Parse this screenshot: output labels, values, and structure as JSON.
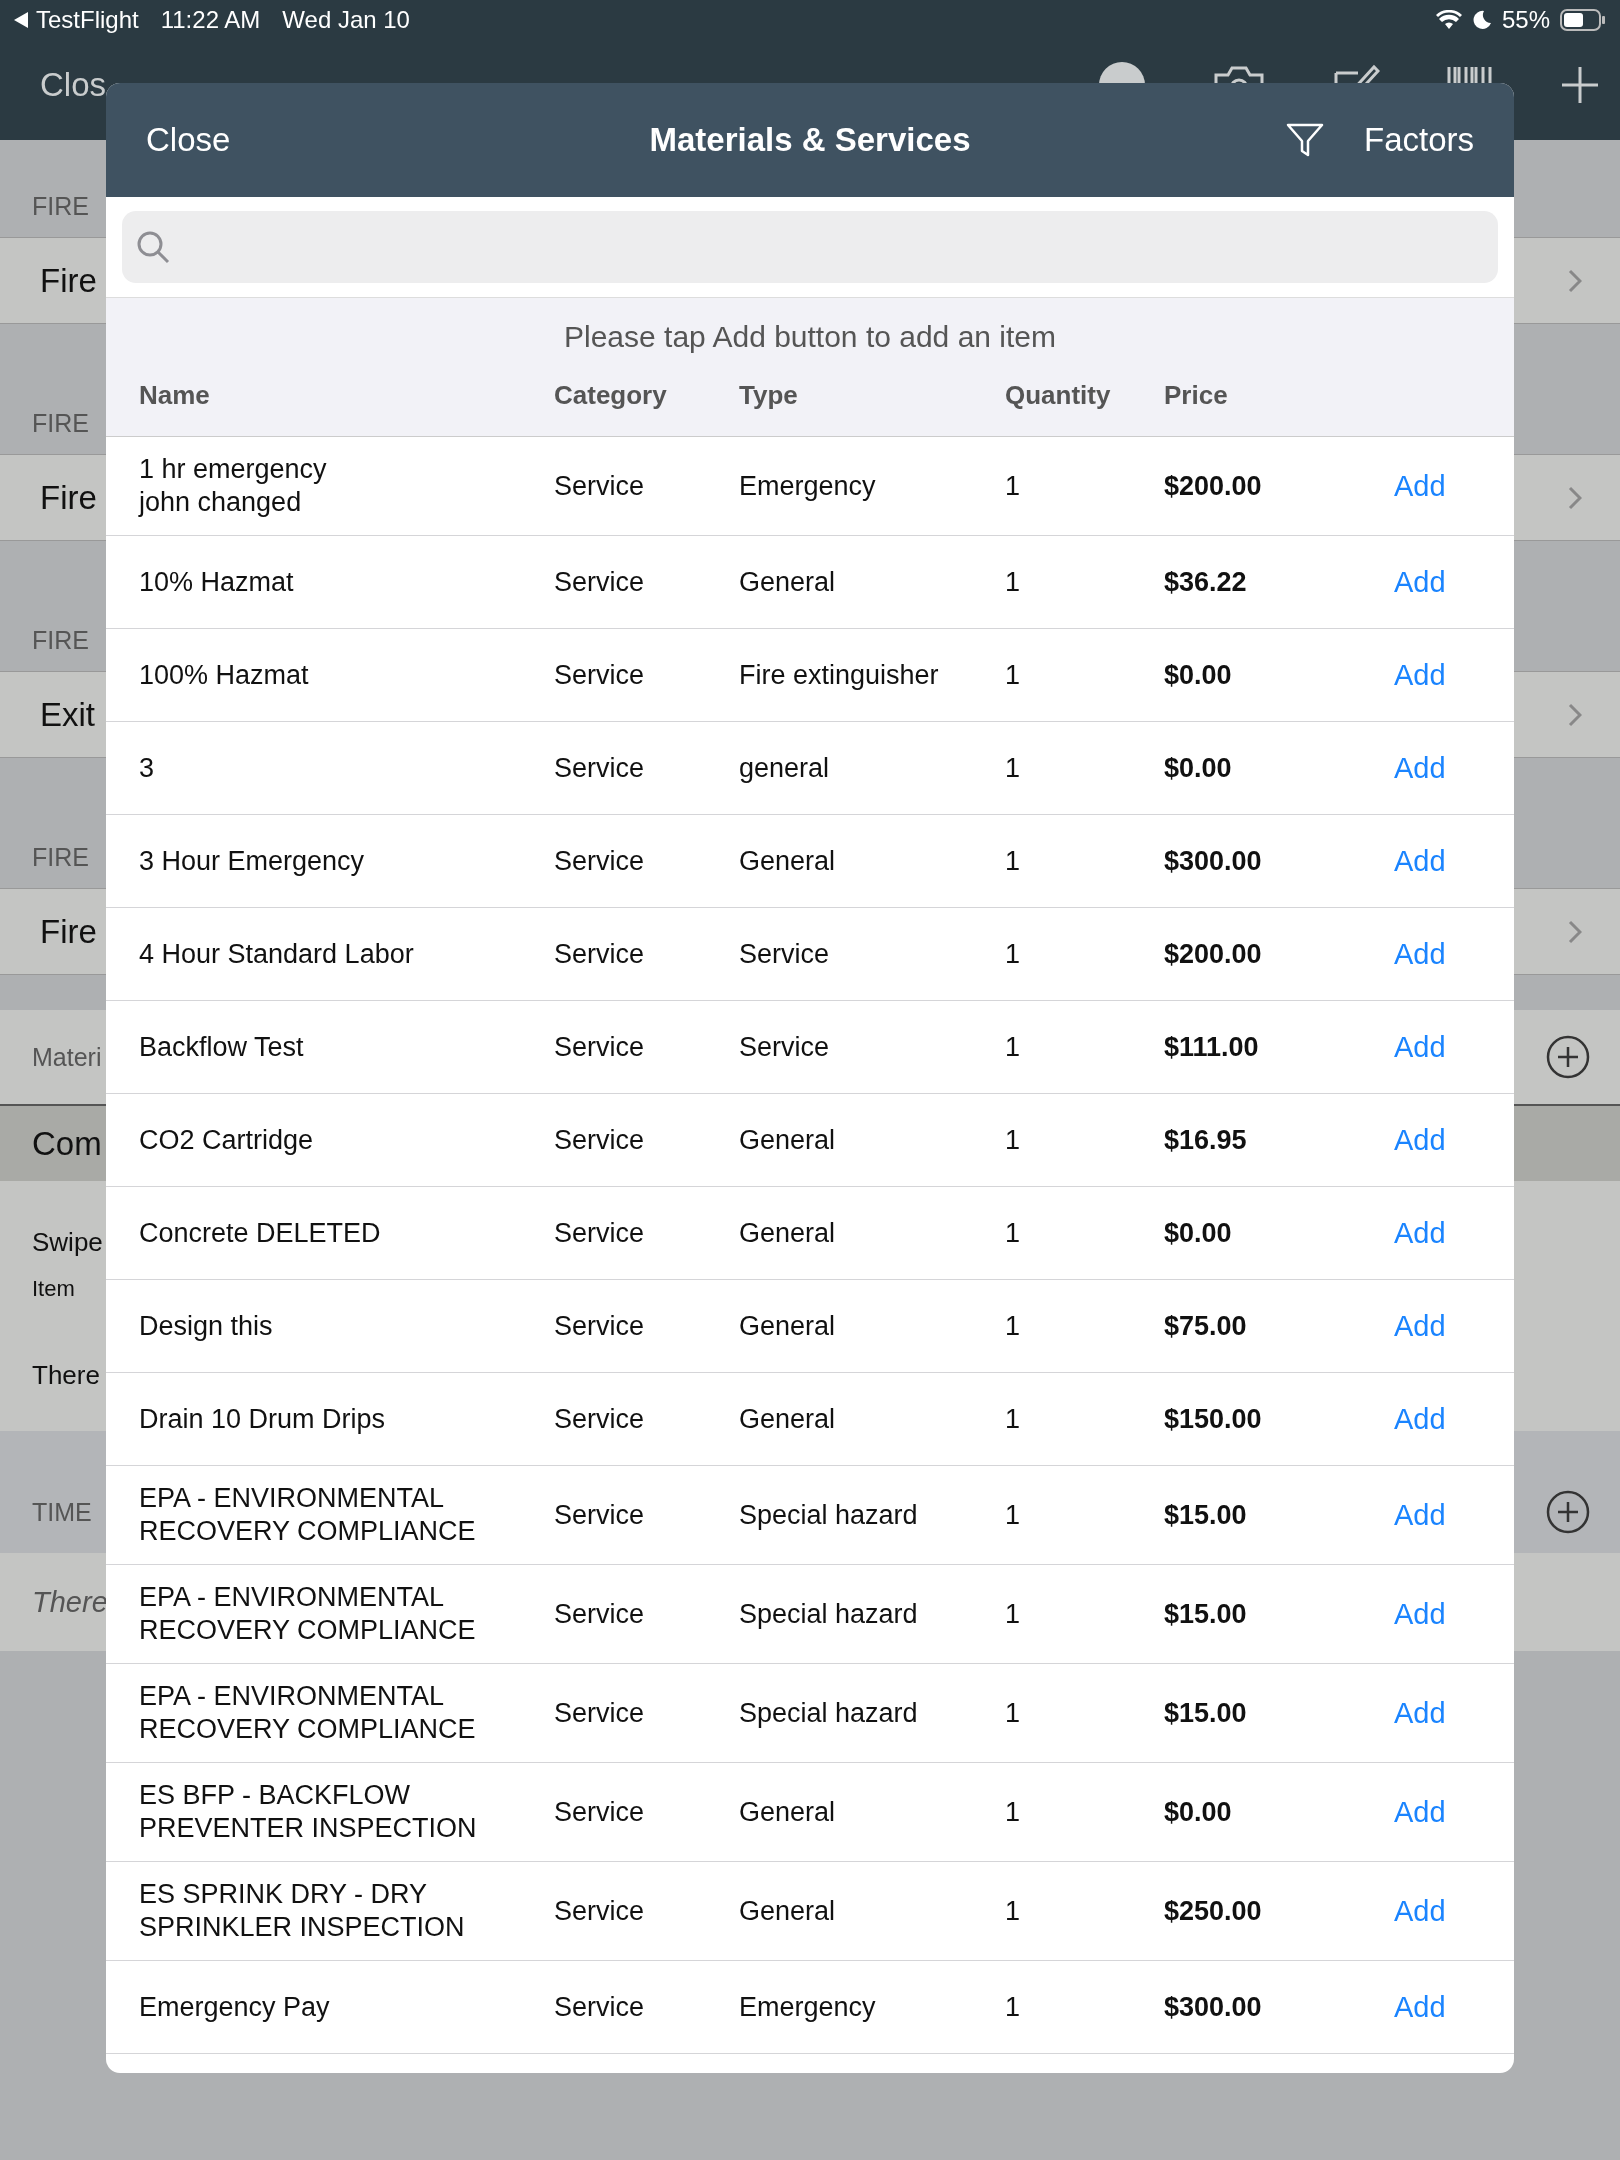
{
  "status_bar": {
    "back_app": "TestFlight",
    "time": "11:22 AM",
    "date": "Wed Jan 10",
    "battery": "55%"
  },
  "background": {
    "close": "Clos",
    "items": [
      {
        "kind": "header",
        "text": "FIRE"
      },
      {
        "kind": "row",
        "text": "Fire"
      },
      {
        "kind": "header",
        "text": "FIRE"
      },
      {
        "kind": "row",
        "text": "Fire"
      },
      {
        "kind": "header",
        "text": "FIRE"
      },
      {
        "kind": "row",
        "text": "Exit"
      },
      {
        "kind": "header",
        "text": "FIRE"
      },
      {
        "kind": "row",
        "text": "Fire"
      },
      {
        "kind": "gap"
      },
      {
        "kind": "add_header",
        "text": "Materi"
      },
      {
        "kind": "dark_row",
        "text": "Com"
      },
      {
        "kind": "note",
        "lines": [
          "Swipe",
          "Item",
          "There"
        ]
      },
      {
        "kind": "add_header",
        "text": "TIME"
      },
      {
        "kind": "italic_row",
        "text": "There"
      }
    ]
  },
  "modal": {
    "close": "Close",
    "title": "Materials & Services",
    "factors": "Factors",
    "hint": "Please tap Add button to add an item",
    "columns": [
      "Name",
      "Category",
      "Type",
      "Quantity",
      "Price"
    ],
    "rows": [
      {
        "name": "1 hr emergency\njohn changed",
        "category": "Service",
        "type": "Emergency",
        "quantity": "1",
        "price": "$200.00",
        "action": "Add"
      },
      {
        "name": "10% Hazmat",
        "category": "Service",
        "type": "General",
        "quantity": "1",
        "price": "$36.22",
        "action": "Add"
      },
      {
        "name": "100% Hazmat",
        "category": "Service",
        "type": "Fire extinguisher",
        "quantity": "1",
        "price": "$0.00",
        "action": "Add"
      },
      {
        "name": "3",
        "category": "Service",
        "type": "general",
        "quantity": "1",
        "price": "$0.00",
        "action": "Add"
      },
      {
        "name": "3 Hour Emergency",
        "category": "Service",
        "type": "General",
        "quantity": "1",
        "price": "$300.00",
        "action": "Add"
      },
      {
        "name": "4 Hour Standard Labor",
        "category": "Service",
        "type": "Service",
        "quantity": "1",
        "price": "$200.00",
        "action": "Add"
      },
      {
        "name": "Backflow Test",
        "category": "Service",
        "type": "Service",
        "quantity": "1",
        "price": "$111.00",
        "action": "Add"
      },
      {
        "name": "CO2 Cartridge",
        "category": "Service",
        "type": "General",
        "quantity": "1",
        "price": "$16.95",
        "action": "Add"
      },
      {
        "name": "Concrete DELETED",
        "category": "Service",
        "type": "General",
        "quantity": "1",
        "price": "$0.00",
        "action": "Add"
      },
      {
        "name": "Design this",
        "category": "Service",
        "type": "General",
        "quantity": "1",
        "price": "$75.00",
        "action": "Add"
      },
      {
        "name": "Drain 10 Drum Drips",
        "category": "Service",
        "type": "General",
        "quantity": "1",
        "price": "$150.00",
        "action": "Add"
      },
      {
        "name": "EPA - ENVIRONMENTAL\nRECOVERY COMPLIANCE",
        "category": "Service",
        "type": "Special hazard",
        "quantity": "1",
        "price": "$15.00",
        "action": "Add"
      },
      {
        "name": "EPA - ENVIRONMENTAL\nRECOVERY COMPLIANCE",
        "category": "Service",
        "type": "Special hazard",
        "quantity": "1",
        "price": "$15.00",
        "action": "Add"
      },
      {
        "name": "EPA - ENVIRONMENTAL\nRECOVERY COMPLIANCE",
        "category": "Service",
        "type": "Special hazard",
        "quantity": "1",
        "price": "$15.00",
        "action": "Add"
      },
      {
        "name": "ES BFP - BACKFLOW\nPREVENTER INSPECTION",
        "category": "Service",
        "type": "General",
        "quantity": "1",
        "price": "$0.00",
        "action": "Add"
      },
      {
        "name": "ES SPRINK DRY - DRY\nSPRINKLER INSPECTION",
        "category": "Service",
        "type": "General",
        "quantity": "1",
        "price": "$250.00",
        "action": "Add"
      },
      {
        "name": "Emergency Pay",
        "category": "Service",
        "type": "Emergency",
        "quantity": "1",
        "price": "$300.00",
        "action": "Add"
      }
    ]
  }
}
